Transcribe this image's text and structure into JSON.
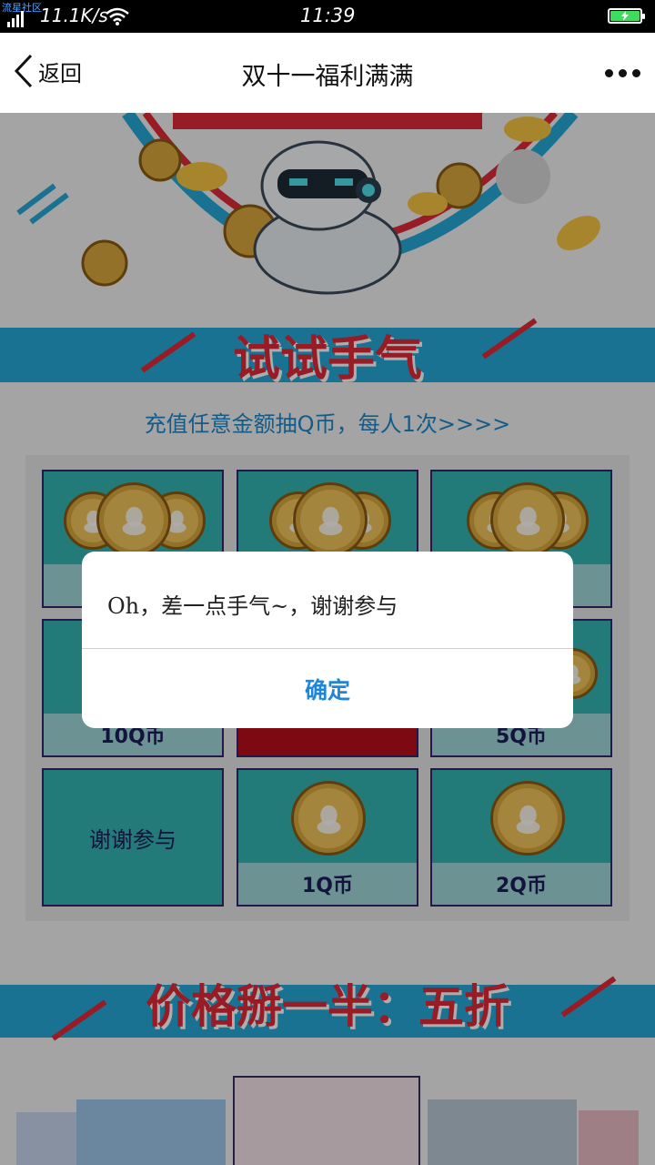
{
  "status_bar": {
    "watermark": "流星社区",
    "network_speed": "11.1K/s",
    "time": "11:39"
  },
  "nav": {
    "back_label": "返回",
    "title": "双十一福利满满"
  },
  "page": {
    "banner1_title": "试试手气",
    "subtitle": "充值任意金额抽Q币，每人1次>>>>",
    "prize_tiles": [
      {
        "label": ""
      },
      {
        "label": ""
      },
      {
        "label": ""
      },
      {
        "label": "10Q币"
      },
      {
        "label": ""
      },
      {
        "label": "5Q币"
      },
      {
        "label": "谢谢参与"
      },
      {
        "label": "1Q币"
      },
      {
        "label": "2Q币"
      }
    ],
    "banner2_title": "价格掰一半：五折"
  },
  "dialog": {
    "message": "Oh，差一点手气~，谢谢参与",
    "confirm_label": "确定"
  },
  "colors": {
    "accent_blue": "#26a9d8",
    "banner_red": "#e02a39",
    "tile_teal": "#33b5b3",
    "button_blue": "#1f86d9"
  }
}
